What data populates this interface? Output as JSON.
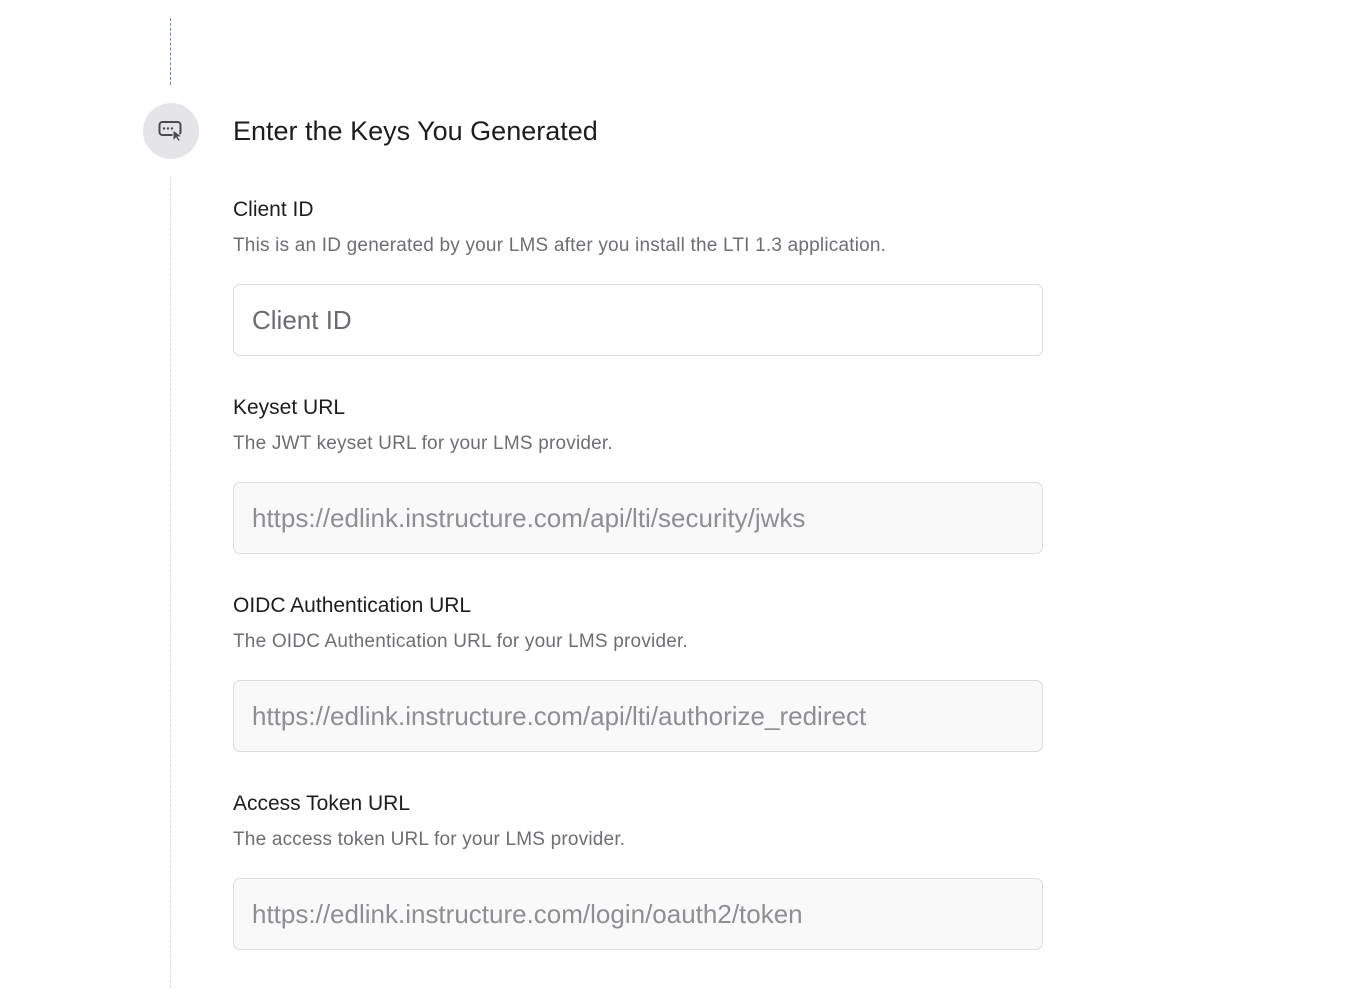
{
  "section": {
    "title": "Enter the Keys You Generated",
    "icon": "keyboard-cursor-icon"
  },
  "fields": [
    {
      "label": "Client ID",
      "description": "This is an ID generated by your LMS after you install the LTI 1.3 application.",
      "value": "",
      "placeholder": "Client ID"
    },
    {
      "label": "Keyset URL",
      "description": "The JWT keyset URL for your LMS provider.",
      "value": "",
      "placeholder": "https://edlink.instructure.com/api/lti/security/jwks"
    },
    {
      "label": "OIDC Authentication URL",
      "description": "The OIDC Authentication URL for your LMS provider.",
      "value": "",
      "placeholder": "https://edlink.instructure.com/api/lti/authorize_redirect"
    },
    {
      "label": "Access Token URL",
      "description": "The access token URL for your LMS provider.",
      "value": "",
      "placeholder": "https://edlink.instructure.com/login/oauth2/token"
    }
  ],
  "colors": {
    "timeline_active": "#6f86b0",
    "timeline_inactive": "#d9d9dc",
    "badge_bg": "#e5e5e8",
    "text_primary": "#1d1d1f",
    "text_secondary": "#6e6e73"
  }
}
